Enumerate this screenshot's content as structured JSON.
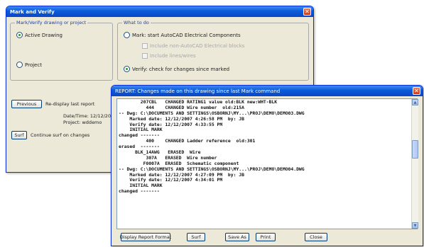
{
  "mark_verify": {
    "title": "Mark and Verify",
    "group_left_legend": "Mark/Verify drawing or project",
    "option_active_drawing": "Active Drawing",
    "option_project": "Project",
    "group_right_legend": "What to do",
    "option_mark": "Mark: start AutoCAD Electrical Components",
    "include_non_ace": "Include non-AutoCAD Electrical blocks",
    "include_lines": "Include lines/wires",
    "option_verify": "Verify: check for changes since marked",
    "previous_button": "Previous",
    "redisplay_label": "Re-display last report",
    "date_time_label": "Date/Time: 12/12/2007",
    "project_label": "Project: wddemo",
    "surf_button": "Surf",
    "continue_surf_label": "Continue surf on changes"
  },
  "report": {
    "title": "REPORT: Changes made on this drawing since last Mark command",
    "lines": [
      "        207CBL   CHANGED RATING1 value old:BLK new:WHT-BLK",
      "          444    CHANGED Wire number  old:215A",
      "-- Dwg: C:\\DOCUMENTS AND SETTINGS\\OSBORNJ\\MY...\\PROJ\\DEMO\\DEMO03.DWG",
      "    Marked date: 12/12/2007 4:26:58 PM  by: JB",
      "    Verify date: 12/12/2007 4:33:55 PM",
      "    INITIAL MARK",
      "changed -------",
      "          400    CHANGED Ladder reference  old:301",
      "erased  -------",
      "      BLK_14AWG   ERASED  Wire",
      "          307A   ERASED  Wire number",
      "         F0007A  ERASED  Schematic component",
      "-- Dwg: C:\\DOCUMENTS AND SETTINGS\\OSBORNJ\\MY...\\PROJ\\DEMO\\DEMO04.DWG",
      "    Marked date: 12/12/2007 4:27:09 PM  by: JB",
      "    Verify date: 12/12/2007 4:34:01 PM",
      "    INITIAL MARK",
      "changed -------"
    ],
    "display_format_button": "Display Report Format",
    "surf_button": "Surf",
    "save_as_button": "Save As",
    "print_button": "Print",
    "close_button": "Close"
  }
}
